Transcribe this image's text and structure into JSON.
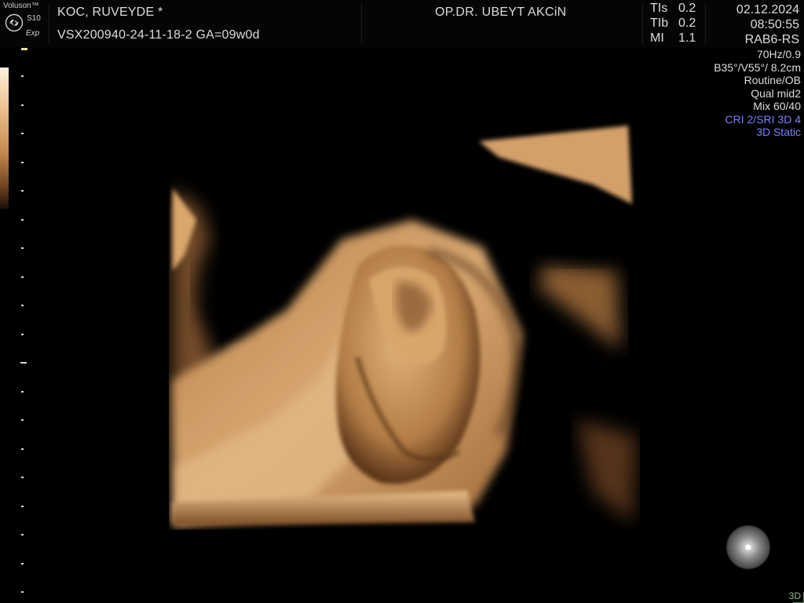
{
  "header": {
    "brand": "Voluson™",
    "model": "S10",
    "variant": "Exp",
    "patient_name": "KOC, RUVEYDE  *",
    "patient_id": "VSX200940-24-11-18-2  GA=09w0d",
    "doctor": "OP.DR. UBEYT AKCiN",
    "ti": [
      {
        "label": "TIs",
        "value": "0.2"
      },
      {
        "label": "TIb",
        "value": "0.2"
      },
      {
        "label": "MI",
        "value": "1.1"
      }
    ],
    "date": "02.12.2024",
    "time": "08:50:55",
    "probe": "RAB6-RS"
  },
  "params": {
    "line1": "70Hz/0.9",
    "line2": "B35°/V55°/ 8.2cm",
    "line3": "Routine/OB",
    "line4": "Qual mid2",
    "line5": "Mix 60/40",
    "line6": "CRI 2/SRI 3D 4",
    "line7": "3D Static"
  },
  "footer": {
    "mode_label": "3D"
  },
  "colors": {
    "accent_blue": "#7f7fff",
    "sepia_light": "#f2d2a0",
    "sepia_mid": "#c58a4e",
    "sepia_dark": "#3a2210",
    "mode_green": "#8fbf8f"
  }
}
